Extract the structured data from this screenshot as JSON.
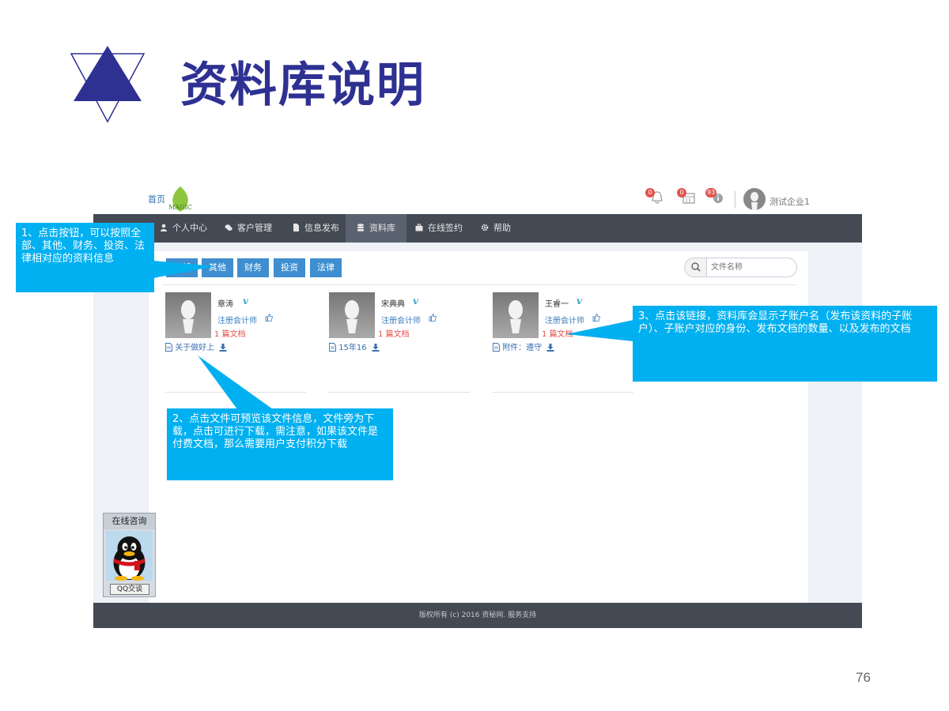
{
  "slide": {
    "title": "资料库说明",
    "page_number": "76"
  },
  "header": {
    "home_link": "首页",
    "logo_text": "MAGIC",
    "badges": [
      "0",
      "0",
      "93"
    ],
    "user_name": "测试企业1"
  },
  "nav": {
    "items": [
      {
        "label": "个人中心",
        "icon": "user-icon"
      },
      {
        "label": "客户管理",
        "icon": "chat-icon"
      },
      {
        "label": "信息发布",
        "icon": "document-icon"
      },
      {
        "label": "资料库",
        "icon": "database-icon",
        "active": true
      },
      {
        "label": "在线签约",
        "icon": "briefcase-icon"
      },
      {
        "label": "帮助",
        "icon": "gear-icon"
      }
    ]
  },
  "filters": [
    "全部",
    "其他",
    "财务",
    "投资",
    "法律"
  ],
  "search": {
    "placeholder": "文件名称"
  },
  "cards": [
    {
      "name": "章涛",
      "role": "注册会计师",
      "docs": "1 篇文档",
      "file": "关于做好上"
    },
    {
      "name": "宋典典",
      "role": "注册会计师",
      "docs": "1 篇文档",
      "file": "15年16"
    },
    {
      "name": "王睿一",
      "role": "注册会计师",
      "docs": "1 篇文档",
      "file": "附件：遵守"
    }
  ],
  "footer": {
    "text": "版权所有 (c) 2016 资秘网. 服务支持"
  },
  "qq_widget": {
    "title": "在线咨询",
    "button": "QQ交谈"
  },
  "callouts": {
    "c1": "1、点击按钮，可以按照全部、其他、财务、投资、法律相对应的资料信息",
    "c2": "2、点击文件可预览该文件信息，文件旁为下载，点击可进行下载，需注意，如果该文件是付费文档，那么需要用户支付积分下载",
    "c3": "3、点击该链接，资料库会显示子账户名（发布该资料的子账户）、子账户对应的身份、发布文档的数量、以及发布的文档"
  },
  "colors": {
    "title": "#2e3192",
    "navbar": "#434a54",
    "filter_button": "#3e8ed0",
    "callout": "#00b0f0",
    "badge": "#e2524e"
  }
}
